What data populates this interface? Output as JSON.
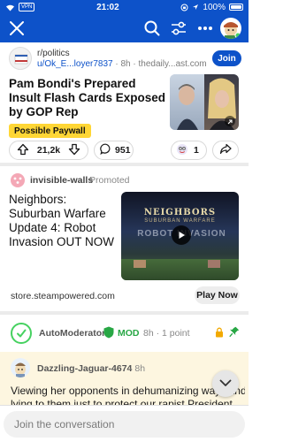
{
  "status_bar": {
    "time": "21:02",
    "vpn": "VPN",
    "battery": "100%"
  },
  "post": {
    "subreddit": "r/politics",
    "author": "u/Ok_E...loyer7837",
    "age": "8h",
    "domain": "thedaily...ast.com",
    "join_label": "Join",
    "title": "Pam Bondi's Prepared Insult Flash Cards Exposed by GOP Rep",
    "flair": "Possible Paywall",
    "score": "21,2k",
    "comment_count": "951",
    "award_count": "1"
  },
  "promoted": {
    "advertiser": "invisible-walls",
    "label": "Promoted",
    "title": "Neighbors: Suburban Warfare Update 4: Robot Invasion OUT NOW",
    "media_title": "NEIGHBORS",
    "media_subtitle": "SUBURBAN WARFARE",
    "media_overlay": "ROBOT INVASION",
    "domain": "store.steampowered.com",
    "cta_label": "Play Now"
  },
  "automod": {
    "name": "AutoModerator",
    "badge": "MOD",
    "meta": "8h · 1 point"
  },
  "comment": {
    "author": "Dazzling-Jaguar-4674",
    "meta": "· 8h",
    "line1": "Viewing her opponents in dehumanizing ways and",
    "line2": "lying to them just to protect our rapist President"
  },
  "reply": {
    "placeholder": "Join the conversation"
  },
  "colors": {
    "brand_blue": "#0d52c9",
    "flair_yellow": "#ffd635",
    "mod_green": "#28a745"
  }
}
